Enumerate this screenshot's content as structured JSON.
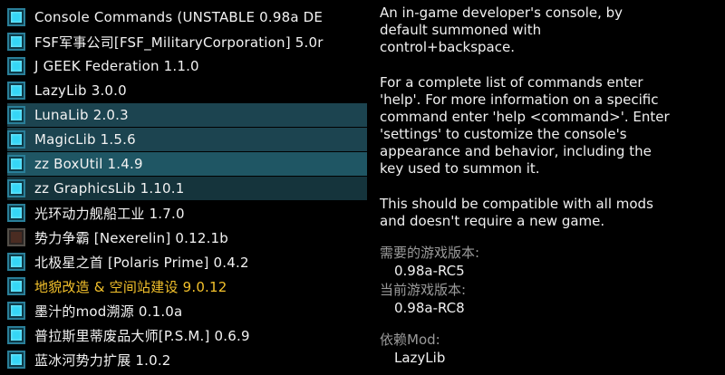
{
  "mods": [
    {
      "name": "Console Commands (UNSTABLE 0.98a DE",
      "enabled": true,
      "highlight": "none",
      "color": "normal"
    },
    {
      "name": "FSF军事公司[FSF_MilitaryCorporation] 5.0r",
      "enabled": true,
      "highlight": "none",
      "color": "normal"
    },
    {
      "name": "J GEEK Federation 1.1.0",
      "enabled": true,
      "highlight": "none",
      "color": "normal"
    },
    {
      "name": "LazyLib 3.0.0",
      "enabled": true,
      "highlight": "none",
      "color": "normal"
    },
    {
      "name": "LunaLib 2.0.3",
      "enabled": true,
      "highlight": "sel-a",
      "color": "normal"
    },
    {
      "name": "MagicLib 1.5.6",
      "enabled": true,
      "highlight": "sel-a",
      "color": "normal"
    },
    {
      "name": "zz BoxUtil 1.4.9",
      "enabled": true,
      "highlight": "sel-c",
      "color": "normal"
    },
    {
      "name": "zz GraphicsLib 1.10.1",
      "enabled": true,
      "highlight": "sel-b",
      "color": "normal"
    },
    {
      "name": "光环动力舰船工业 1.7.0",
      "enabled": true,
      "highlight": "none",
      "color": "normal"
    },
    {
      "name": "势力争霸 [Nexerelin] 0.12.1b",
      "enabled": false,
      "highlight": "none",
      "color": "normal"
    },
    {
      "name": "北极星之首 [Polaris Prime] 0.4.2",
      "enabled": true,
      "highlight": "none",
      "color": "normal"
    },
    {
      "name": "地貌改造 & 空间站建设 9.0.12",
      "enabled": true,
      "highlight": "none",
      "color": "gold"
    },
    {
      "name": "墨汁的mod溯源 0.1.0a",
      "enabled": true,
      "highlight": "none",
      "color": "normal"
    },
    {
      "name": "普拉斯里蒂废品大师[P.S.M.] 0.6.9",
      "enabled": true,
      "highlight": "none",
      "color": "normal"
    },
    {
      "name": "蓝冰河势力扩展 1.0.2",
      "enabled": true,
      "highlight": "none",
      "color": "normal"
    }
  ],
  "details": {
    "description_lines": [
      "An in-game developer's console, by",
      "default summoned with",
      "control+backspace."
    ],
    "help_lines": [
      "For a complete list of commands enter",
      "'help'. For more information on a specific",
      "command enter 'help <command>'. Enter",
      "'settings' to customize the console's",
      "appearance and behavior, including the",
      "key used to summon it."
    ],
    "compat_lines": [
      "This should be compatible with all mods",
      "and doesn't require a new game."
    ],
    "required_version_label": "需要的游戏版本:",
    "required_version_value": "0.98a-RC5",
    "current_version_label": "当前游戏版本:",
    "current_version_value": "0.98a-RC8",
    "dependency_label": "依赖Mod:",
    "dependency_value": "LazyLib"
  },
  "colors": {
    "checkbox_on": "#35d6f6",
    "highlight_row": "#1c4450",
    "gold_text": "#f3c12b",
    "muted_label": "#9a9a9a"
  }
}
